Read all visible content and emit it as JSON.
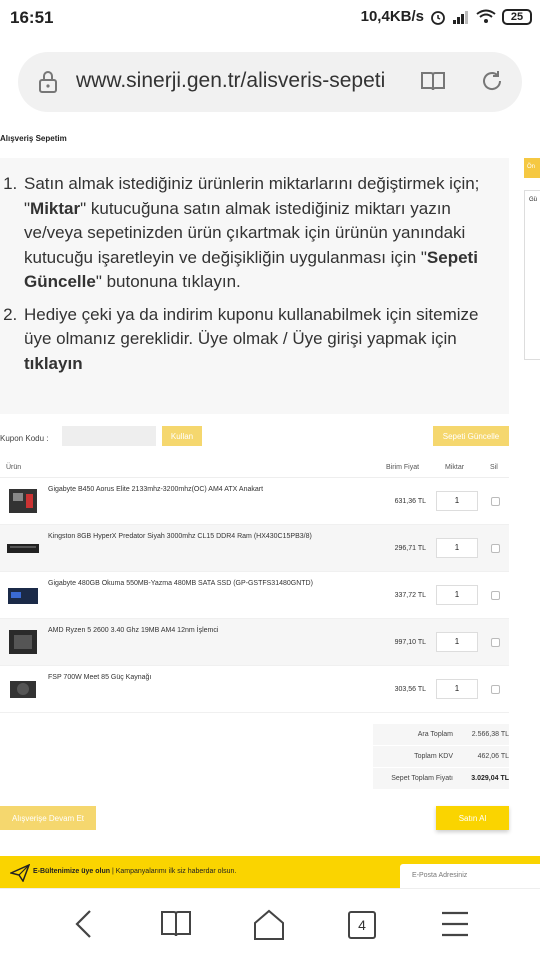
{
  "status_bar": {
    "time": "16:51",
    "net_speed": "10,4KB/s",
    "battery": "25"
  },
  "browser": {
    "url": "www.sinerji.gen.tr/alisveris-sepeti",
    "tab_count": "4"
  },
  "page": {
    "title": "Alışveriş Sepetim",
    "instructions": {
      "item1_parts": [
        "Satın almak istediğiniz ürünlerin miktarlarını değiştirmek için; \"",
        "Miktar",
        "\" kutucuğuna satın almak istediğiniz miktarı yazın ve/veya sepetinizden ürün çıkartmak için ürünün yanındaki kutucuğu işaretleyin ve değişikliğin uygulanması için \"",
        "Sepeti Güncelle",
        "\" butonuna tıklayın."
      ],
      "item2_parts": [
        "Hediye çeki ya da indirim kuponu kullanabilmek için sitemize üye olmanız gereklidir. Üye olmak / Üye girişi yapmak için ",
        "tıklayın"
      ]
    },
    "side": {
      "button_label": "Ön",
      "box_label": "Gü"
    },
    "coupon": {
      "label": "Kupon Kodu :",
      "placeholder": "",
      "apply_label": "Kullan",
      "update_label": "Sepeti Güncelle"
    },
    "cart": {
      "headers": {
        "product": "Ürün",
        "unit_price": "Birim Fiyat",
        "quantity": "Miktar",
        "delete": "Sil"
      },
      "rows": [
        {
          "name": "Gigabyte B450 Aorus Elite 2133mhz-3200mhz(OC) AM4 ATX Anakart",
          "price": "631,36 TL",
          "qty": "1"
        },
        {
          "name": "Kingston 8GB HyperX Predator Siyah 3000mhz CL15 DDR4 Ram (HX430C15PB3/8)",
          "price": "296,71 TL",
          "qty": "1"
        },
        {
          "name": "Gigabyte 480GB Okuma 550MB-Yazma 480MB SATA SSD (GP-GSTFS31480GNTD)",
          "price": "337,72 TL",
          "qty": "1"
        },
        {
          "name": "AMD Ryzen 5 2600 3.40 Ghz 19MB AM4 12nm İşlemci",
          "price": "997,10 TL",
          "qty": "1"
        },
        {
          "name": "FSP 700W Meet 85 Güç Kaynağı",
          "price": "303,56 TL",
          "qty": "1"
        }
      ]
    },
    "totals": {
      "subtotal_label": "Ara Toplam",
      "subtotal": "2.566,38 TL",
      "vat_label": "Toplam KDV",
      "vat": "462,06 TL",
      "grand_label": "Sepet Toplam Fiyatı",
      "grand": "3.029,04 TL"
    },
    "actions": {
      "continue_label": "Alışverişe Devam Et",
      "buy_label": "Satın Al"
    },
    "newsletter": {
      "bold": "E-Bültenimize üye olun",
      "text": " | Kampanyalarımı ilk siz haberdar olsun.",
      "email_placeholder": "E-Posta Adresiniz"
    }
  }
}
